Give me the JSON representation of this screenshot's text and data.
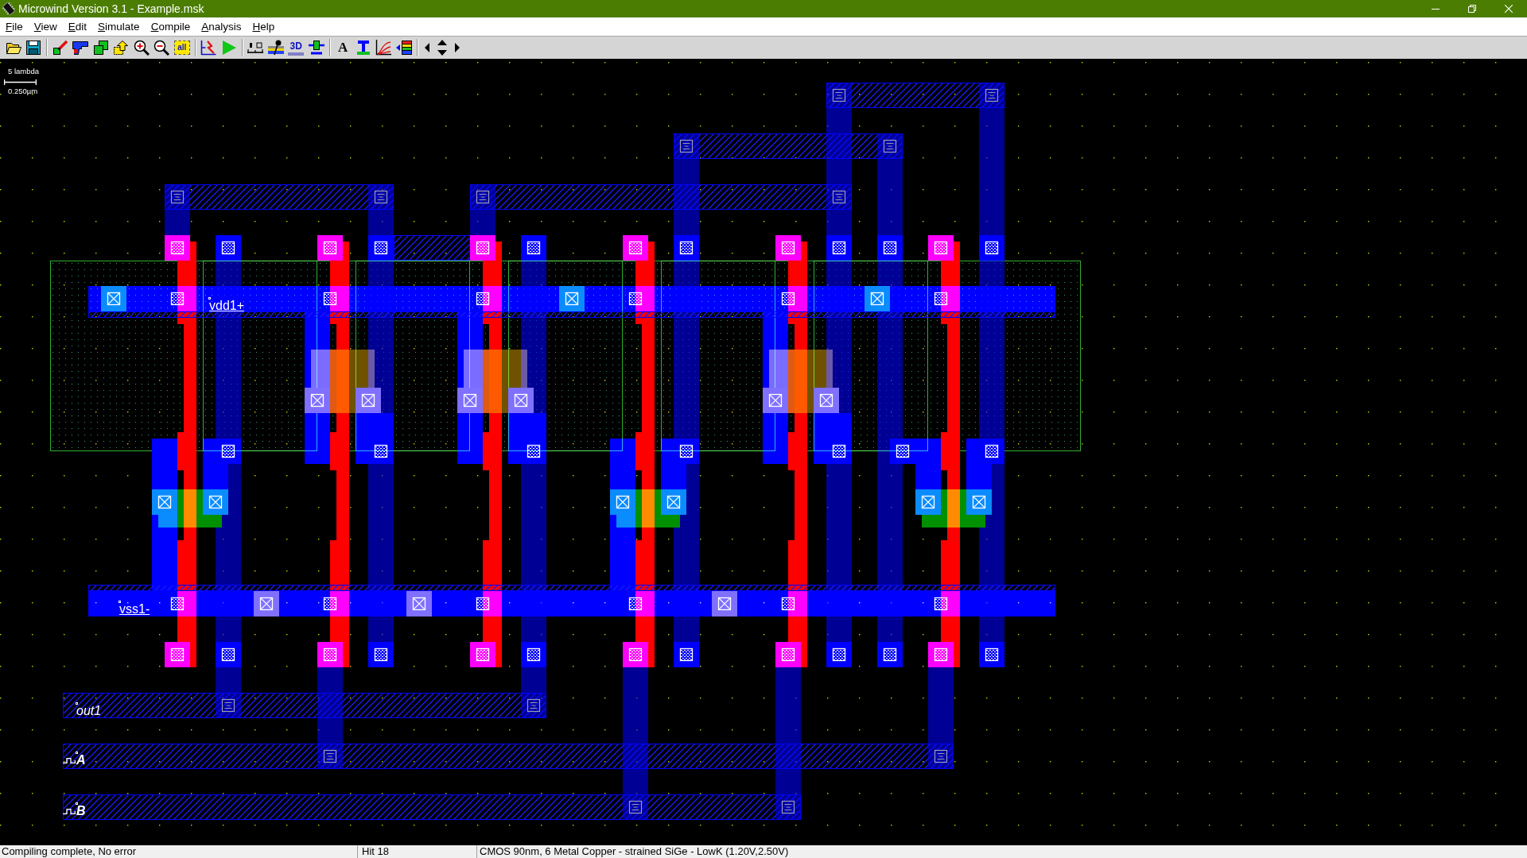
{
  "window": {
    "title": "Microwind Version 3.1 - Example.msk"
  },
  "menu": [
    "File",
    "View",
    "Edit",
    "Simulate",
    "Compile",
    "Analysis",
    "Help"
  ],
  "toolbar": [
    {
      "kind": "open"
    },
    {
      "kind": "save"
    },
    {
      "kind": "separator"
    },
    {
      "kind": "draw-box"
    },
    {
      "kind": "gun"
    },
    {
      "kind": "duplicate"
    },
    {
      "kind": "stretch"
    },
    {
      "kind": "zoom-in"
    },
    {
      "kind": "zoom-out"
    },
    {
      "kind": "view-all",
      "label": "all"
    },
    {
      "kind": "separator"
    },
    {
      "kind": "compile"
    },
    {
      "kind": "simulate"
    },
    {
      "kind": "separator"
    },
    {
      "kind": "measure"
    },
    {
      "kind": "cross-section"
    },
    {
      "kind": "view-3d",
      "label": "3D"
    },
    {
      "kind": "device"
    },
    {
      "kind": "separator"
    },
    {
      "kind": "text",
      "label": "A"
    },
    {
      "kind": "process"
    },
    {
      "kind": "curves"
    },
    {
      "kind": "layers"
    },
    {
      "kind": "separator"
    },
    {
      "kind": "scroll-left"
    },
    {
      "kind": "scroll-vertical"
    },
    {
      "kind": "scroll-right"
    }
  ],
  "scale": {
    "units": "5 lambda",
    "length": "0.250µm"
  },
  "layout": {
    "labels": [
      {
        "kind": "supply",
        "text": "vdd1+"
      },
      {
        "kind": "supply",
        "text": "vss1-"
      },
      {
        "kind": "output",
        "text": "out1"
      },
      {
        "kind": "clock",
        "text": "A"
      },
      {
        "kind": "clock",
        "text": "B"
      }
    ]
  },
  "status_bar": {
    "message": "Compiling complete, No error",
    "hits": "Hit 18",
    "technology": "CMOS 90nm, 6 Metal Copper - strained SiGe - LowK (1.20V,2.50V)"
  }
}
